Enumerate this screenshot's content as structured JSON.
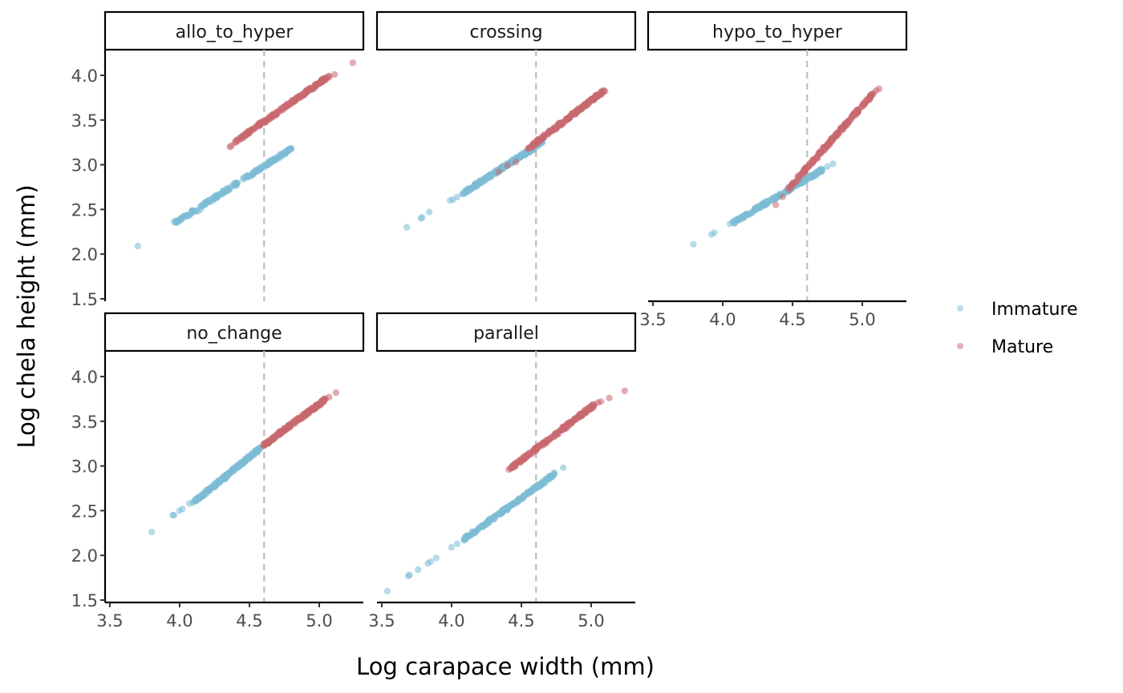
{
  "chart_data": {
    "type": "scatter",
    "title": "",
    "xlabel": "Log carapace width (mm)",
    "ylabel": "Log chela height (mm)",
    "xlim": [
      3.466,
      5.316
    ],
    "ylim": [
      1.473,
      4.287
    ],
    "x_ticks": [
      3.5,
      4.0,
      4.5,
      5.0
    ],
    "x_tick_labels": [
      "3.5",
      "4.0",
      "4.5",
      "5.0"
    ],
    "y_ticks": [
      1.5,
      2.0,
      2.5,
      3.0,
      3.5,
      4.0
    ],
    "y_tick_labels": [
      "1.5",
      "2.0",
      "2.5",
      "3.0",
      "3.5",
      "4.0"
    ],
    "reference_line": {
      "orientation": "vertical",
      "x": 4.605,
      "style": "dashed",
      "color": "#BEBEBE"
    },
    "grid": false,
    "legend": {
      "placement": "right",
      "entries": [
        {
          "name": "Immature",
          "color": "#7BBCD5"
        },
        {
          "name": "Mature",
          "color": "#C9686F"
        }
      ]
    },
    "point_alpha": 0.55,
    "facets": [
      {
        "name": "allo_to_hyper",
        "series": [
          {
            "name": "Immature",
            "segments": [
              [
                3.97,
                2.35,
                4.8,
                3.18
              ]
            ],
            "count": 180,
            "outliers": [
              [
                3.7,
                2.09
              ],
              [
                3.96,
                2.36
              ],
              [
                3.99,
                2.38
              ],
              [
                4.02,
                2.4
              ],
              [
                4.06,
                2.44
              ],
              [
                4.08,
                2.45
              ],
              [
                4.13,
                2.48
              ],
              [
                4.15,
                2.5
              ]
            ]
          },
          {
            "name": "Mature",
            "segments": [
              [
                4.4,
                3.26,
                5.07,
                3.99
              ]
            ],
            "count": 180,
            "outliers": [
              [
                4.36,
                3.2
              ],
              [
                4.37,
                3.21
              ],
              [
                4.42,
                3.27
              ],
              [
                5.11,
                4.01
              ],
              [
                5.24,
                4.14
              ]
            ]
          }
        ]
      },
      {
        "name": "crossing",
        "series": [
          {
            "name": "Immature",
            "segments": [
              [
                4.08,
                2.68,
                4.65,
                3.25
              ]
            ],
            "count": 180,
            "outliers": [
              [
                3.68,
                2.3
              ],
              [
                3.78,
                2.4
              ],
              [
                3.79,
                2.41
              ],
              [
                3.84,
                2.47
              ],
              [
                3.99,
                2.6
              ],
              [
                4.01,
                2.61
              ],
              [
                4.04,
                2.64
              ],
              [
                4.7,
                3.38
              ],
              [
                4.76,
                3.44
              ]
            ]
          },
          {
            "name": "Mature",
            "segments": [
              [
                4.55,
                3.18,
                5.1,
                3.84
              ]
            ],
            "count": 180,
            "outliers": [
              [
                4.34,
                2.92
              ],
              [
                4.4,
                2.99
              ],
              [
                4.46,
                3.03
              ]
            ]
          }
        ]
      },
      {
        "name": "hypo_to_hyper",
        "series": [
          {
            "name": "Immature",
            "segments": [
              [
                4.04,
                2.32,
                4.72,
                2.95
              ]
            ],
            "count": 180,
            "outliers": [
              [
                3.79,
                2.11
              ],
              [
                3.92,
                2.22
              ],
              [
                3.94,
                2.24
              ],
              [
                4.75,
                2.98
              ],
              [
                4.79,
                3.01
              ]
            ]
          },
          {
            "name": "Mature",
            "segments": [
              [
                4.47,
                2.73,
                5.08,
                3.8
              ]
            ],
            "count": 180,
            "outliers": [
              [
                4.38,
                2.55
              ],
              [
                4.43,
                2.64
              ],
              [
                4.51,
                2.79
              ],
              [
                5.1,
                3.83
              ],
              [
                5.12,
                3.85
              ]
            ]
          }
        ]
      },
      {
        "name": "no_change",
        "series": [
          {
            "name": "Immature",
            "segments": [
              [
                4.09,
                2.58,
                4.58,
                3.2
              ]
            ],
            "count": 180,
            "outliers": [
              [
                3.8,
                2.26
              ],
              [
                3.95,
                2.45
              ],
              [
                3.96,
                2.45
              ],
              [
                4.0,
                2.5
              ],
              [
                4.02,
                2.52
              ],
              [
                4.07,
                2.58
              ],
              [
                4.61,
                3.24
              ],
              [
                4.63,
                3.25
              ]
            ]
          },
          {
            "name": "Mature",
            "segments": [
              [
                4.6,
                3.23,
                5.04,
                3.74
              ]
            ],
            "count": 180,
            "outliers": [
              [
                5.07,
                3.77
              ],
              [
                5.12,
                3.82
              ]
            ]
          }
        ]
      },
      {
        "name": "parallel",
        "series": [
          {
            "name": "Immature",
            "segments": [
              [
                4.08,
                2.17,
                4.74,
                2.91
              ]
            ],
            "count": 180,
            "outliers": [
              [
                3.54,
                1.6
              ],
              [
                3.69,
                1.77
              ],
              [
                3.7,
                1.78
              ],
              [
                3.76,
                1.84
              ],
              [
                3.83,
                1.91
              ],
              [
                3.85,
                1.93
              ],
              [
                3.89,
                1.97
              ],
              [
                4.0,
                2.09
              ],
              [
                4.04,
                2.13
              ],
              [
                4.8,
                2.98
              ]
            ]
          },
          {
            "name": "Mature",
            "segments": [
              [
                4.42,
                2.97,
                5.02,
                3.68
              ]
            ],
            "count": 180,
            "outliers": [
              [
                4.41,
                2.96
              ],
              [
                5.05,
                3.71
              ],
              [
                5.07,
                3.72
              ],
              [
                5.13,
                3.76
              ],
              [
                5.24,
                3.84
              ]
            ]
          }
        ]
      }
    ]
  }
}
